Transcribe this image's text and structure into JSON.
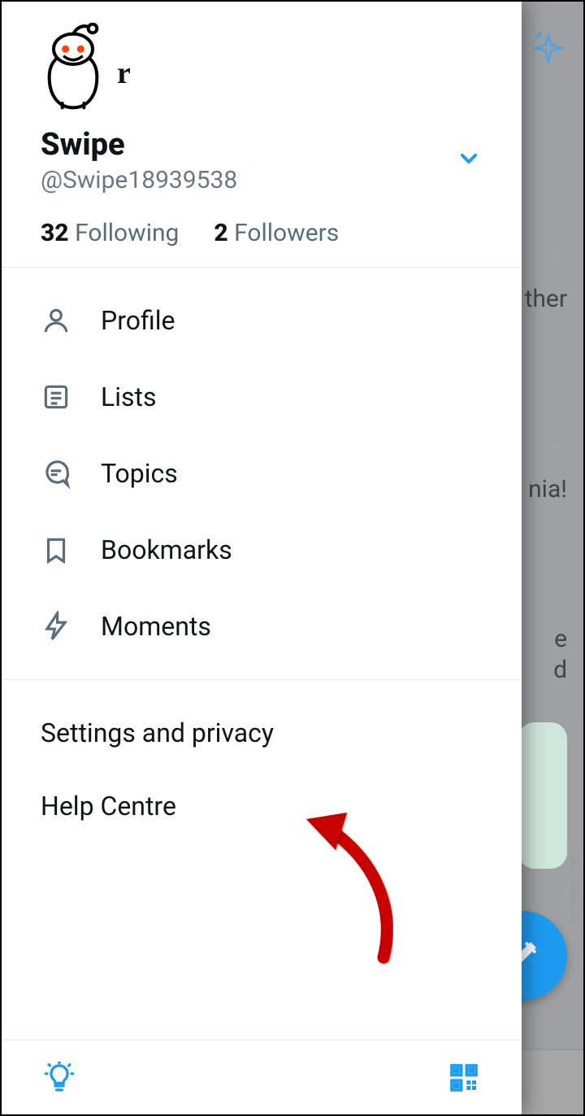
{
  "drawer": {
    "avatar_badge": "r",
    "display_name": "Swipe",
    "handle": "@Swipe18939538",
    "following_count": "32",
    "following_label": "Following",
    "followers_count": "2",
    "followers_label": "Followers",
    "menu": [
      {
        "label": "Profile",
        "icon": "person-icon"
      },
      {
        "label": "Lists",
        "icon": "list-icon"
      },
      {
        "label": "Topics",
        "icon": "topics-icon"
      },
      {
        "label": "Bookmarks",
        "icon": "bookmark-icon"
      },
      {
        "label": "Moments",
        "icon": "moments-icon"
      }
    ],
    "secondary": {
      "settings": "Settings and privacy",
      "help": "Help Centre"
    }
  },
  "background": {
    "row1_text": "ther",
    "row2_text": "nia!",
    "row3a": "e",
    "row3b": "d"
  },
  "watermark": "www.deuaq.com",
  "colors": {
    "accent": "#1d9bf0",
    "icon_muted": "#5b6b79",
    "handle": "#6b7785"
  }
}
